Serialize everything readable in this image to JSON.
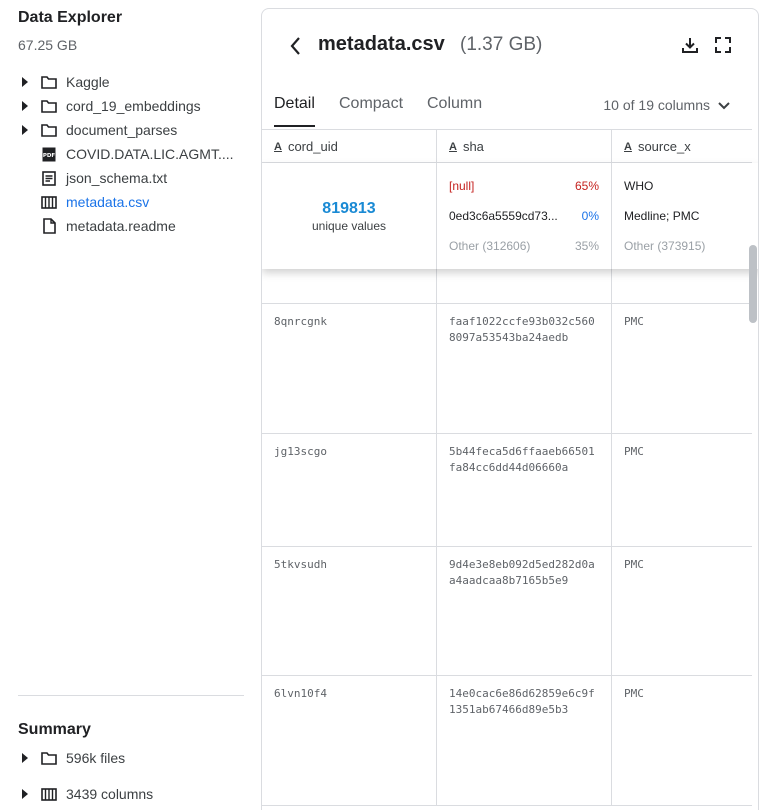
{
  "sidebar": {
    "title": "Data Explorer",
    "size": "67.25 GB",
    "items": [
      {
        "label": "Kaggle",
        "icon": "folder-icon",
        "expandable": true
      },
      {
        "label": "cord_19_embeddings",
        "icon": "folder-icon",
        "expandable": true
      },
      {
        "label": "document_parses",
        "icon": "folder-icon",
        "expandable": true
      },
      {
        "label": "COVID.DATA.LIC.AGMT....",
        "icon": "pdf-icon",
        "expandable": false
      },
      {
        "label": "json_schema.txt",
        "icon": "text-file-icon",
        "expandable": false
      },
      {
        "label": "metadata.csv",
        "icon": "table-icon",
        "expandable": false,
        "active": true
      },
      {
        "label": "metadata.readme",
        "icon": "file-icon",
        "expandable": false
      }
    ]
  },
  "summary": {
    "title": "Summary",
    "items": [
      {
        "label": "596k files",
        "icon": "folder-icon"
      },
      {
        "label": "3439 columns",
        "icon": "table-icon"
      }
    ]
  },
  "file": {
    "name": "metadata.csv",
    "size": "(1.37 GB)"
  },
  "tabs": [
    {
      "label": "Detail",
      "active": true
    },
    {
      "label": "Compact",
      "active": false
    },
    {
      "label": "Column",
      "active": false
    }
  ],
  "column_count": "10 of 19 columns",
  "columns": [
    {
      "name": "cord_uid",
      "type_icon": "A"
    },
    {
      "name": "sha",
      "type_icon": "A"
    },
    {
      "name": "source_x",
      "type_icon": "A"
    }
  ],
  "column_summary": {
    "cord_uid": {
      "unique_count": "819813",
      "unique_label": "unique values"
    },
    "sha": {
      "null_label": "[null]",
      "null_pct": "65%",
      "top_value": "0ed3c6a5559cd73...",
      "top_pct": "0%",
      "other_label": "Other (312606)",
      "other_pct": "35%"
    },
    "source_x": {
      "values": [
        "WHO",
        "Medline; PMC"
      ],
      "other_label": "Other (373915)"
    }
  },
  "rows": [
    {
      "cord_uid": "8qnrcgnk",
      "sha": "faaf1022ccfe93b032c5608097a53543ba24aedb",
      "source_x": "PMC"
    },
    {
      "cord_uid": "jg13scgo",
      "sha": "5b44feca5d6ffaaeb66501fa84cc6dd44d06660a",
      "source_x": "PMC"
    },
    {
      "cord_uid": "5tkvsudh",
      "sha": "9d4e3e8eb092d5ed282d0aa4aadcaa8b7165b5e9",
      "source_x": "PMC"
    },
    {
      "cord_uid": "6lvn10f4",
      "sha": "14e0cac6e86d62859e6c9f1351ab67466d89e5b3",
      "source_x": "PMC"
    }
  ]
}
